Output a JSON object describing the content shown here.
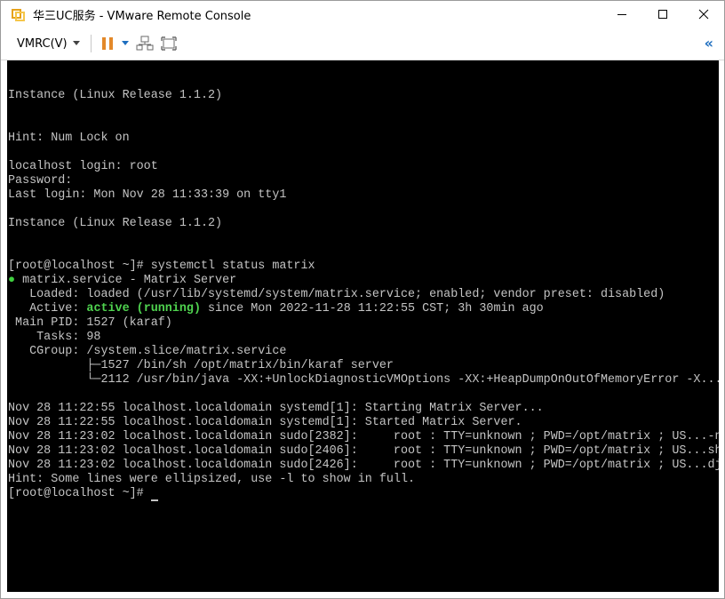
{
  "window": {
    "title": "华三UC服务 - VMware Remote Console",
    "controls": {
      "minimize": "—",
      "maximize": "☐",
      "close": "✕"
    }
  },
  "toolbar": {
    "vmrc_label": "VMRC(V)",
    "collapse_glyph": "«"
  },
  "colors": {
    "accent": "#1e6ebf",
    "pause": "#e3892a",
    "terminal_bg": "#000000",
    "terminal_fg": "#c4c4c4",
    "active_green": "#4fd34f"
  },
  "console": {
    "lines": [
      "",
      "",
      "Instance (Linux Release 1.1.2)",
      "",
      "",
      "Hint: Num Lock on",
      "",
      "localhost login: root",
      "Password:",
      "Last login: Mon Nov 28 11:33:39 on tty1",
      "",
      "Instance (Linux Release 1.1.2)",
      "",
      "",
      "[root@localhost ~]# systemctl status matrix",
      {
        "bullet": "●",
        "text": " matrix.service - Matrix Server"
      },
      "   Loaded: loaded (/usr/lib/systemd/system/matrix.service; enabled; vendor preset: disabled)",
      {
        "pre": "   Active: ",
        "hl": "active (running)",
        "post": " since Mon 2022-11-28 11:22:55 CST; 3h 30min ago"
      },
      " Main PID: 1527 (karaf)",
      "    Tasks: 98",
      "   CGroup: /system.slice/matrix.service",
      "           ├─1527 /bin/sh /opt/matrix/bin/karaf server",
      "           └─2112 /usr/bin/java -XX:+UnlockDiagnosticVMOptions -XX:+HeapDumpOnOutOfMemoryError -X...",
      "",
      "Nov 28 11:22:55 localhost.localdomain systemd[1]: Starting Matrix Server...",
      "Nov 28 11:22:55 localhost.localdomain systemd[1]: Started Matrix Server.",
      "Nov 28 11:23:02 localhost.localdomain sudo[2382]:     root : TTY=unknown ; PWD=/opt/matrix ; US...-n",
      "Nov 28 11:23:02 localhost.localdomain sudo[2406]:     root : TTY=unknown ; PWD=/opt/matrix ; US...sh",
      "Nov 28 11:23:02 localhost.localdomain sudo[2426]:     root : TTY=unknown ; PWD=/opt/matrix ; US...dj",
      "Hint: Some lines were ellipsized, use -l to show in full.",
      {
        "prompt": "[root@localhost ~]# ",
        "cursor": true
      }
    ]
  }
}
